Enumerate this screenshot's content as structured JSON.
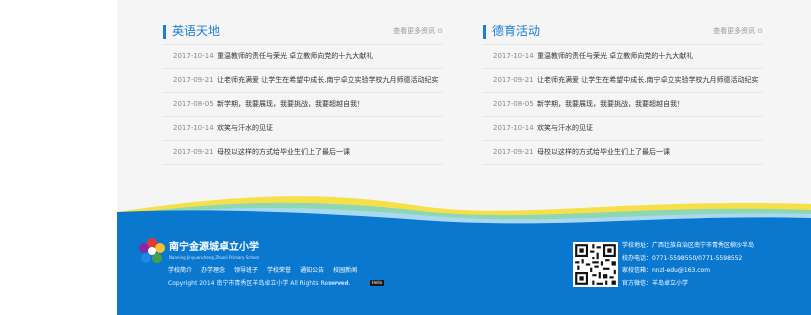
{
  "sections": [
    {
      "title": "英语天地",
      "more": "查看更多资讯",
      "items": [
        {
          "date": "2017-10-14",
          "title": "重温教师的责任与荣光 卓立教师向党的十九大献礼"
        },
        {
          "date": "2017-09-21",
          "title": "让老师充满爱 让学生在希望中成长.南宁卓立实验学校九月师德活动纪实"
        },
        {
          "date": "2017-08-05",
          "title": "新学期，我要展现，我要挑战，我要超越自我！"
        },
        {
          "date": "2017-10-14",
          "title": "欢笑与汗水的见证"
        },
        {
          "date": "2017-09-21",
          "title": "母校以这样的方式给毕业生们上了最后一课"
        }
      ]
    },
    {
      "title": "德育活动",
      "more": "查看更多资讯",
      "items": [
        {
          "date": "2017-10-14",
          "title": "重温教师的责任与荣光 卓立教师向党的十九大献礼"
        },
        {
          "date": "2017-09-21",
          "title": "让老师充满爱 让学生在希望中成长.南宁卓立实验学校九月师德活动纪实"
        },
        {
          "date": "2017-08-05",
          "title": "新学期，我要展现，我要挑战，我要超越自我！"
        },
        {
          "date": "2017-10-14",
          "title": "欢笑与汗水的见证"
        },
        {
          "date": "2017-09-21",
          "title": "母校以这样的方式给毕业生们上了最后一课"
        }
      ]
    }
  ],
  "footer": {
    "school_name": "南宁金源城卓立小学",
    "school_name_en": "Nanning Jinyuancheng Zhuoli Primary School",
    "nav": [
      "学校简介",
      "办学理念",
      "领导班子",
      "学校荣誉",
      "通知公告",
      "校园新闻"
    ],
    "copyright": "Copyright 2014 南宁市青秀区羊岛卓立小学 All Rights Reserved.",
    "powered_by": "POWERED BY",
    "powered_badge": "Hello",
    "contact": [
      "学校地址：广西壮族自治区南宁市青秀区柳沙半岛",
      "校办电话：0771-5598550/0771-5598552",
      "家校信箱：nnzl-edu@163.com",
      "官方微信：羊岛卓立小学"
    ]
  },
  "colors": {
    "accent": "#1e7bd6",
    "footer_blue": "#0b78cf",
    "wave_yellow": "#f5e04a",
    "wave_green": "#8fd6b4",
    "wave_light": "#a9d9f2"
  },
  "icons": {
    "more": "arrow-circle-icon",
    "logo": "flower-logo-icon",
    "qr": "qr-code-icon"
  }
}
